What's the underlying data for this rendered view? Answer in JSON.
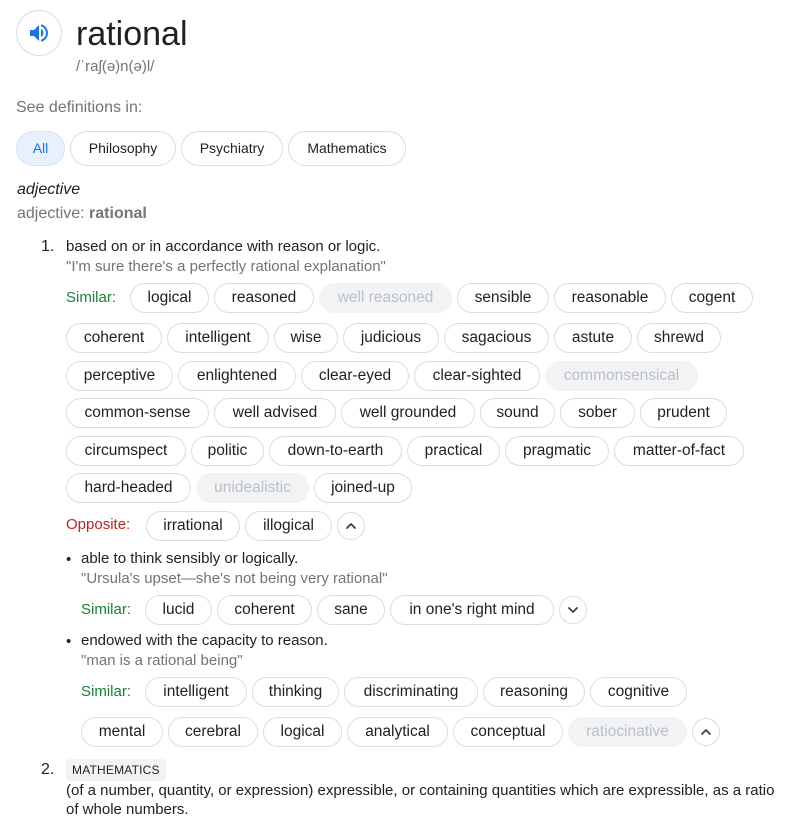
{
  "header": {
    "word": "rational",
    "phonetic": "/ˈraʃ(ə)n(ə)l/",
    "audio_icon": "speaker-icon"
  },
  "categories": {
    "prompt": "See definitions in:",
    "items": [
      "All",
      "Philosophy",
      "Psychiatry",
      "Mathematics"
    ],
    "selected": "All"
  },
  "entry": {
    "part_of_speech": "adjective",
    "pos_label": "adjective:",
    "pos_word": "rational"
  },
  "labels": {
    "similar": "Similar:",
    "opposite": "Opposite:"
  },
  "sense1": {
    "number": "1.",
    "definition": "based on or in accordance with reason or logic.",
    "example": "\"I'm sure there's a perfectly rational explanation\"",
    "similar_row1": [
      "logical",
      "reasoned",
      "well reasoned",
      "sensible",
      "reasonable",
      "cogent"
    ],
    "similar_row2": [
      "coherent",
      "intelligent",
      "wise",
      "judicious",
      "sagacious",
      "astute",
      "shrewd"
    ],
    "similar_row3": [
      "perceptive",
      "enlightened",
      "clear-eyed",
      "clear-sighted",
      "commonsensical"
    ],
    "similar_row4": [
      "common-sense",
      "well advised",
      "well grounded",
      "sound",
      "sober",
      "prudent"
    ],
    "similar_row5": [
      "circumspect",
      "politic",
      "down-to-earth",
      "practical",
      "pragmatic",
      "matter-of-fact"
    ],
    "similar_row6": [
      "hard-headed",
      "unidealistic",
      "joined-up"
    ],
    "opposites": [
      "irrational",
      "illogical"
    ],
    "dimmed": [
      "well reasoned",
      "commonsensical",
      "unidealistic"
    ]
  },
  "subsense1": {
    "definition": "able to think sensibly or logically.",
    "example": "\"Ursula's upset—she's not being very rational\"",
    "similar": [
      "lucid",
      "coherent",
      "sane",
      "in one's right mind"
    ]
  },
  "subsense2": {
    "definition": "endowed with the capacity to reason.",
    "example": "\"man is a rational being\"",
    "similar_row1": [
      "intelligent",
      "thinking",
      "discriminating",
      "reasoning",
      "cognitive"
    ],
    "similar_row2": [
      "mental",
      "cerebral",
      "logical",
      "analytical",
      "conceptual",
      "ratiocinative"
    ],
    "dimmed": [
      "ratiocinative"
    ]
  },
  "sense2": {
    "number": "2.",
    "domain": "MATHEMATICS",
    "definition": "(of a number, quantity, or expression) expressible, or containing quantities which are expressible, as a ratio of whole numbers."
  },
  "colors": {
    "accent": "#1a73e8",
    "similar": "#188038",
    "opposite": "#c5221f",
    "muted": "#70757a"
  }
}
